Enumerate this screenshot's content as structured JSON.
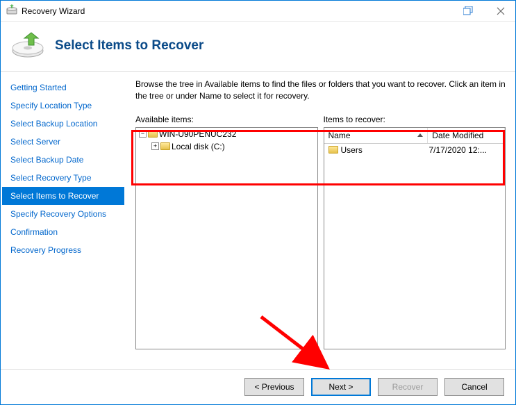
{
  "window": {
    "title": "Recovery Wizard"
  },
  "header": {
    "title": "Select Items to Recover"
  },
  "sidebar": {
    "steps": [
      {
        "label": "Getting Started"
      },
      {
        "label": "Specify Location Type"
      },
      {
        "label": "Select Backup Location"
      },
      {
        "label": "Select Server"
      },
      {
        "label": "Select Backup Date"
      },
      {
        "label": "Select Recovery Type"
      },
      {
        "label": "Select Items to Recover"
      },
      {
        "label": "Specify Recovery Options"
      },
      {
        "label": "Confirmation"
      },
      {
        "label": "Recovery Progress"
      }
    ],
    "selectedIndex": 6
  },
  "content": {
    "instructions": "Browse the tree in Available items to find the files or folders that you want to recover. Click an item in the tree or under Name to select it for recovery.",
    "availableLabel": "Available items:",
    "recoverLabel": "Items to recover:",
    "tree": {
      "root": {
        "label": "WIN-U90PENUC232",
        "expanded": true
      },
      "children": [
        {
          "label": "Local disk (C:)",
          "expanded": false
        }
      ]
    },
    "table": {
      "columns": {
        "name": "Name",
        "date": "Date Modified"
      },
      "rows": [
        {
          "name": "Users",
          "date": "7/17/2020 12:..."
        }
      ]
    }
  },
  "footer": {
    "previous": "< Previous",
    "next": "Next >",
    "recover": "Recover",
    "cancel": "Cancel"
  }
}
